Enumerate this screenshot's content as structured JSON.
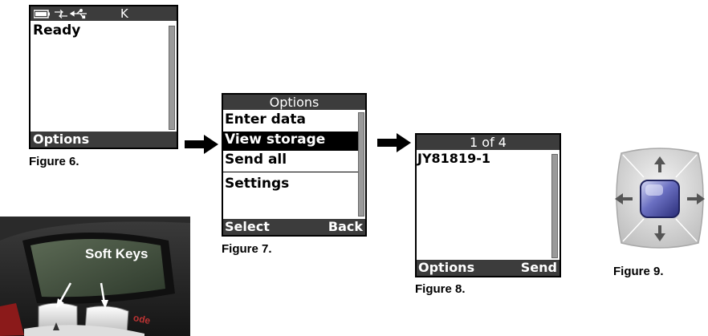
{
  "figure6": {
    "status": "Ready",
    "softkey_left": "Options",
    "caption": "Figure 6.",
    "status_icons": [
      "battery-icon",
      "transfer-arrows-icon",
      "usb-icon",
      "k-indicator"
    ],
    "indicator_letter": "K"
  },
  "figure7": {
    "title": "Options",
    "items": [
      "Enter data",
      "View storage",
      "Send all",
      "Settings"
    ],
    "selected_index": 1,
    "softkey_left": "Select",
    "softkey_right": "Back",
    "caption": "Figure 7."
  },
  "figure8": {
    "title": "1 of 4",
    "record": "JY81819-1",
    "softkey_left": "Options",
    "softkey_right": "Send",
    "caption": "Figure 8."
  },
  "figure9": {
    "caption": "Figure 9.",
    "icon": "navigation-pad-icon"
  },
  "device_photo": {
    "label": "Soft Keys",
    "brand_fragment": "ode"
  },
  "colors": {
    "lcd_bar": "#3c3c3c",
    "highlight": "#000000",
    "nav_center": "#4a4fa0",
    "nav_pad": "#d6d6d6"
  }
}
